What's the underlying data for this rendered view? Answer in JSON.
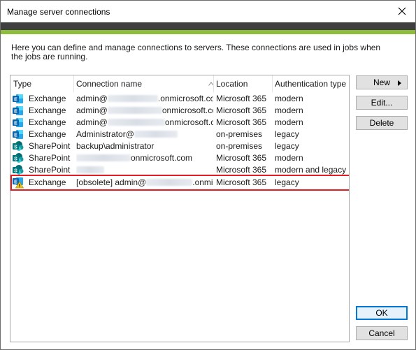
{
  "window": {
    "title": "Manage server connections"
  },
  "colors": {
    "header_dark": "#3f3f3f",
    "header_green": "#8dbd3a",
    "selection_outline": "#e31c23",
    "ok_border": "#0078d7"
  },
  "description": "Here you can define and manage connections to servers. These connections are used in jobs when the jobs are running.",
  "table": {
    "columns": [
      "Type",
      "Connection name",
      "Location",
      "Authentication type"
    ],
    "rows": [
      {
        "icon": "exchange-icon",
        "type": "Exchange",
        "name_prefix": "admin@",
        "name_suffix": ".onmicrosoft.com",
        "location": "Microsoft 365",
        "auth": "modern"
      },
      {
        "icon": "exchange-icon",
        "type": "Exchange",
        "name_prefix": "admin@",
        "name_suffix": "onmicrosoft.com",
        "location": "Microsoft 365",
        "auth": "modern"
      },
      {
        "icon": "exchange-icon",
        "type": "Exchange",
        "name_prefix": "admin@",
        "name_suffix": "onmicrosoft.c...",
        "location": "Microsoft 365",
        "auth": "modern"
      },
      {
        "icon": "exchange-icon",
        "type": "Exchange",
        "name_prefix": "Administrator@",
        "name_suffix": "",
        "location": "on-premises",
        "auth": "legacy"
      },
      {
        "icon": "sharepoint-icon",
        "type": "SharePoint",
        "name_prefix": "backup\\administrator",
        "name_suffix": "",
        "location": "on-premises",
        "auth": "legacy"
      },
      {
        "icon": "sharepoint-icon",
        "type": "SharePoint",
        "name_prefix": "",
        "name_suffix": "onmicrosoft.com",
        "location": "Microsoft 365",
        "auth": "modern"
      },
      {
        "icon": "sharepoint-icon",
        "type": "SharePoint",
        "name_prefix": "",
        "name_suffix": "",
        "location": "Microsoft 365",
        "auth": "modern and legacy"
      },
      {
        "icon": "exchange-warning-icon",
        "type": "Exchange",
        "name_prefix": "[obsolete] admin@",
        "name_suffix": ".onmi...",
        "location": "Microsoft 365",
        "auth": "legacy"
      }
    ]
  },
  "buttons": {
    "new": "New",
    "edit": "Edit...",
    "delete": "Delete",
    "ok": "OK",
    "cancel": "Cancel"
  }
}
